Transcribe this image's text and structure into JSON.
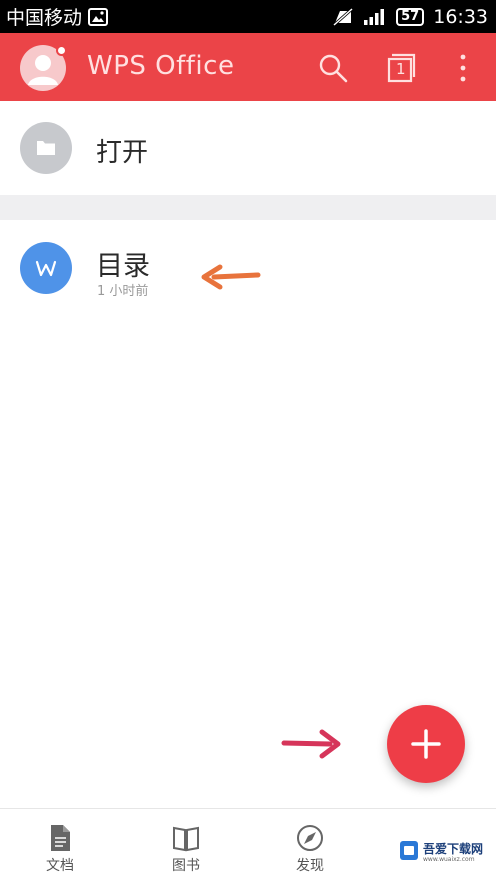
{
  "status_bar": {
    "carrier": "中国移动",
    "battery": "57",
    "time": "16:33"
  },
  "app_bar": {
    "title": "WPS Office",
    "tab_count": "1",
    "icons": [
      "avatar",
      "search-icon",
      "tabs-icon",
      "more-icon"
    ]
  },
  "open_item": {
    "label": "打开",
    "icon": "folder-icon"
  },
  "recent_file": {
    "name": "目录",
    "time": "1 小时前",
    "icon_letter": "W"
  },
  "fab": {
    "icon": "plus-icon"
  },
  "bottom_nav": {
    "items": [
      {
        "label": "文档",
        "icon": "document-icon"
      },
      {
        "label": "图书",
        "icon": "book-icon"
      },
      {
        "label": "发现",
        "icon": "compass-icon"
      }
    ]
  },
  "watermark": {
    "text": "吾爱下载网",
    "sub": "www.wuaixz.com"
  },
  "colors": {
    "brand": "#eb4448",
    "fab": "#ee3d47",
    "file_icon": "#4f93e8",
    "annotation_orange": "#e8733c",
    "annotation_red": "#d6355a"
  }
}
